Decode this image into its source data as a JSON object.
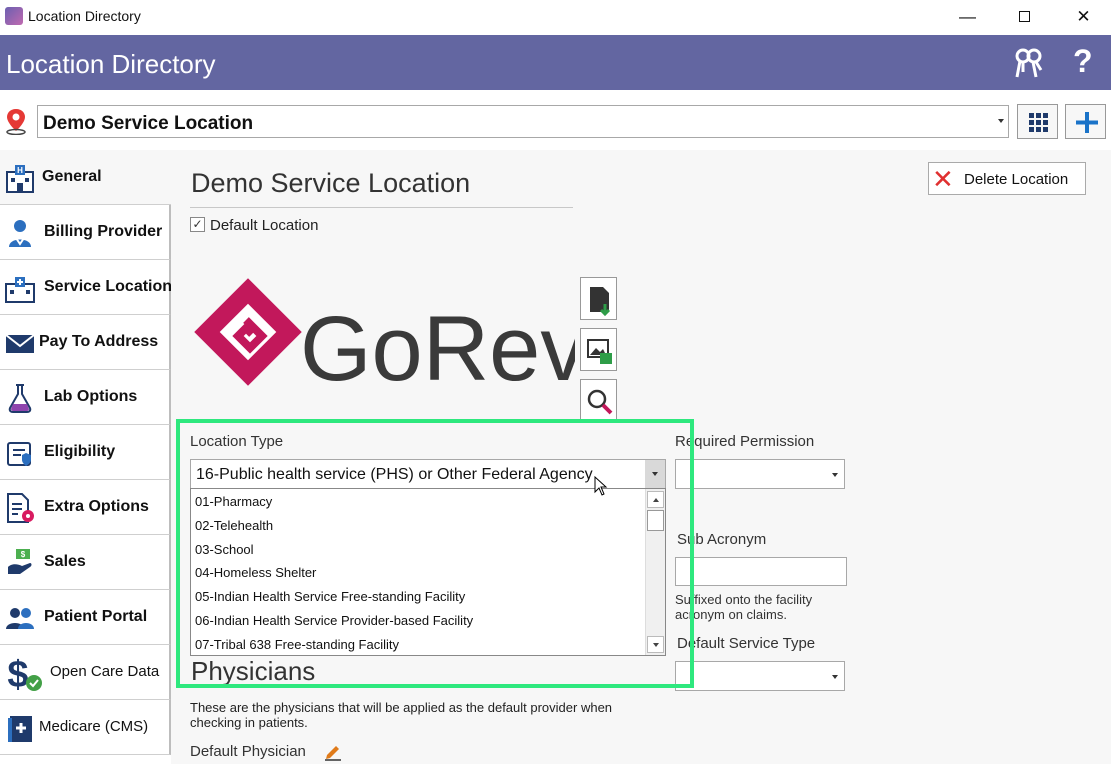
{
  "window": {
    "title": "Location Directory",
    "controls": {
      "minimize": "—",
      "close": "✕"
    }
  },
  "header": {
    "title": "Location Directory",
    "help_label": "?"
  },
  "location_selector": {
    "value": "Demo Service Location"
  },
  "sidebar": {
    "items": [
      {
        "label": "General",
        "icon": "hospital-building-icon",
        "active": true
      },
      {
        "label": "Billing Provider",
        "icon": "doctor-icon"
      },
      {
        "label": "Service Location",
        "icon": "clinic-icon"
      },
      {
        "label": "Pay To Address",
        "icon": "envelope-icon"
      },
      {
        "label": "Lab Options",
        "icon": "flask-icon"
      },
      {
        "label": "Eligibility",
        "icon": "shield-check-icon"
      },
      {
        "label": "Extra Options",
        "icon": "document-gear-icon"
      },
      {
        "label": "Sales",
        "icon": "money-hand-icon"
      },
      {
        "label": "Patient Portal",
        "icon": "users-icon"
      },
      {
        "label": "Open Care Data",
        "icon": "dollar-sign-icon"
      },
      {
        "label": "Medicare (CMS)",
        "icon": "medicare-book-icon"
      }
    ]
  },
  "main": {
    "title": "Demo Service Location",
    "default_location": {
      "label": "Default Location",
      "checked": true,
      "mark": "✓"
    },
    "delete_button": {
      "label": "Delete Location",
      "icon_glyph": "✕"
    },
    "logo_text": "GoRev",
    "location_type": {
      "label": "Location Type",
      "value": "16-Public health service (PHS) or Other Federal Agency",
      "options": [
        "01-Pharmacy",
        "02-Telehealth",
        "03-School",
        "04-Homeless Shelter",
        "05-Indian Health Service Free-standing Facility",
        "06-Indian Health Service Provider-based Facility",
        "07-Tribal 638 Free-standing Facility"
      ]
    },
    "required_permission": {
      "label": "Required Permission",
      "value": ""
    },
    "sub_acronym": {
      "label": "Sub Acronym",
      "value": "",
      "help": "Suffixed onto the facility acronym on claims."
    },
    "default_service_type": {
      "label": "Default Service Type",
      "value": ""
    },
    "physicians": {
      "heading": "Physicians",
      "description": "These are the physicians that will be applied as the default provider when checking in patients.",
      "default_physician_label": "Default Physician"
    }
  },
  "colors": {
    "header_bg": "#6366a1",
    "highlight": "#2ee87e",
    "logo_magenta": "#c2185b",
    "logo_text": "#3a3a3a",
    "delete_red": "#e03030",
    "add_blue": "#1a73c8"
  }
}
